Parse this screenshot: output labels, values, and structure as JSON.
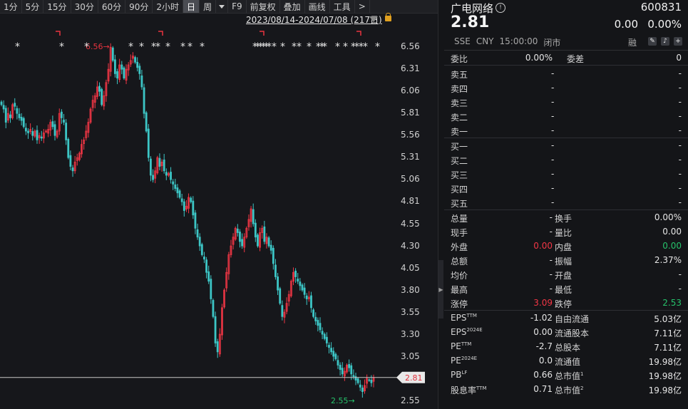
{
  "toolbar": {
    "periods": [
      "1分",
      "5分",
      "15分",
      "30分",
      "60分",
      "90分",
      "2小时",
      "日",
      "周"
    ],
    "active": "日",
    "tools": [
      "F9",
      "前复权",
      "叠加",
      "画线",
      "工具",
      ">"
    ]
  },
  "chart": {
    "range_label": "2023/08/14-2024/07/08 (217日)",
    "current_price_tag": "2.81",
    "high_label": "6.56→",
    "low_label": "2.55→",
    "y_ticks": [
      "6.56",
      "6.31",
      "6.06",
      "5.81",
      "5.56",
      "5.31",
      "5.06",
      "4.81",
      "4.55",
      "4.30",
      "4.05",
      "3.80",
      "3.55",
      "3.30",
      "3.05",
      "2.81",
      "2.55"
    ],
    "colors": {
      "up": "#f23645",
      "down": "#3dc6c6",
      "marker_red": "#e8333f",
      "green_label": "#26c26b"
    }
  },
  "chart_data": {
    "type": "candlestick",
    "ylim": [
      2.55,
      6.56
    ],
    "current": 2.81,
    "high": 6.56,
    "low": 2.55,
    "closes": [
      5.9,
      5.85,
      5.7,
      5.8,
      5.75,
      5.9,
      5.88,
      5.8,
      5.75,
      5.72,
      5.65,
      5.6,
      5.58,
      5.62,
      5.55,
      5.6,
      5.5,
      5.55,
      5.52,
      5.58,
      5.6,
      5.62,
      5.7,
      5.65,
      5.55,
      5.6,
      5.8,
      5.75,
      5.7,
      5.5,
      5.3,
      5.2,
      5.15,
      5.25,
      5.3,
      5.35,
      5.45,
      5.5,
      5.6,
      5.7,
      5.85,
      5.95,
      6.0,
      6.1,
      6.05,
      5.9,
      6.0,
      6.15,
      6.3,
      6.55,
      6.4,
      6.25,
      6.2,
      6.35,
      6.3,
      6.2,
      6.3,
      6.35,
      6.4,
      6.45,
      6.38,
      6.32,
      6.25,
      6.1,
      5.8,
      5.6,
      5.3,
      5.1,
      5.05,
      5.15,
      5.3,
      5.2,
      5.25,
      5.15,
      5.1,
      5.12,
      5.05,
      5.0,
      4.95,
      4.9,
      4.85,
      4.8,
      4.7,
      4.75,
      4.85,
      4.8,
      4.65,
      4.5,
      4.4,
      4.3,
      4.2,
      4.15,
      4.0,
      3.9,
      3.7,
      3.5,
      3.2,
      3.1,
      3.3,
      3.6,
      3.8,
      4.0,
      4.2,
      4.3,
      4.4,
      4.5,
      4.45,
      4.35,
      4.3,
      4.4,
      4.5,
      4.6,
      4.72,
      4.55,
      4.4,
      4.3,
      4.45,
      4.5,
      4.35,
      4.4,
      4.3,
      4.25,
      4.1,
      3.95,
      3.8,
      3.65,
      3.5,
      3.55,
      3.65,
      3.75,
      3.9,
      4.0,
      3.95,
      3.9,
      3.85,
      3.8,
      3.75,
      3.7,
      3.72,
      3.6,
      3.5,
      3.45,
      3.4,
      3.35,
      3.3,
      3.25,
      3.2,
      3.15,
      3.1,
      3.05,
      3.02,
      2.95,
      2.9,
      2.85,
      2.88,
      2.95,
      2.92,
      2.85,
      2.82,
      2.78,
      2.75,
      2.7,
      2.65,
      2.72,
      2.8,
      2.78,
      2.75,
      2.81
    ]
  },
  "quote": {
    "name": "广电网络",
    "code": "600831",
    "price": "2.81",
    "change": "0.00",
    "change_pct": "0.00%",
    "exchange": "SSE",
    "currency": "CNY",
    "time": "15:00:00",
    "status": "闭市",
    "rong": "融"
  },
  "orderbook": {
    "weibi_label": "委比",
    "weibi": "0.00%",
    "weicha_label": "委差",
    "weicha": "0",
    "asks": [
      {
        "label": "卖五",
        "price": "-",
        "vol": "-"
      },
      {
        "label": "卖四",
        "price": "-",
        "vol": "-"
      },
      {
        "label": "卖三",
        "price": "-",
        "vol": "-"
      },
      {
        "label": "卖二",
        "price": "-",
        "vol": "-"
      },
      {
        "label": "卖一",
        "price": "-",
        "vol": "-"
      }
    ],
    "bids": [
      {
        "label": "买一",
        "price": "-",
        "vol": "-"
      },
      {
        "label": "买二",
        "price": "-",
        "vol": "-"
      },
      {
        "label": "买三",
        "price": "-",
        "vol": "-"
      },
      {
        "label": "买四",
        "price": "-",
        "vol": "-"
      },
      {
        "label": "买五",
        "price": "-",
        "vol": "-"
      }
    ]
  },
  "stats": [
    {
      "l1": "总量",
      "v1": "-",
      "l2": "换手",
      "v2": "0.00%"
    },
    {
      "l1": "现手",
      "v1": "-",
      "l2": "量比",
      "v2": "0.00"
    },
    {
      "l1": "外盘",
      "v1": "0.00",
      "l2": "内盘",
      "v2": "0.00",
      "c1": "red",
      "c2": "green"
    },
    {
      "l1": "总额",
      "v1": "-",
      "l2": "振幅",
      "v2": "2.37%"
    },
    {
      "l1": "均价",
      "v1": "-",
      "l2": "开盘",
      "v2": "-"
    },
    {
      "l1": "最高",
      "v1": "-",
      "l2": "最低",
      "v2": "-"
    },
    {
      "l1": "涨停",
      "v1": "3.09",
      "l2": "跌停",
      "v2": "2.53",
      "c1": "red",
      "c2": "green"
    }
  ],
  "fundamentals": [
    {
      "l1": "EPS",
      "s1": "TTM",
      "v1": "-1.02",
      "l2": "自由流通",
      "v2": "5.03亿"
    },
    {
      "l1": "EPS",
      "s1": "2024E",
      "v1": "0.00",
      "l2": "流通股本",
      "v2": "7.11亿"
    },
    {
      "l1": "PE",
      "s1": "TTM",
      "v1": "-2.7",
      "l2": "总股本",
      "v2": "7.11亿"
    },
    {
      "l1": "PE",
      "s1": "2024E",
      "v1": "0.0",
      "l2": "流通值",
      "v2": "19.98亿"
    },
    {
      "l1": "PB",
      "s1": "LF",
      "v1": "0.66",
      "l2": "总市值",
      "s2": "1",
      "v2": "19.98亿"
    },
    {
      "l1": "股息率",
      "s1": "TTM",
      "v1": "0.71",
      "l2": "总市值",
      "s2": "2",
      "v2": "19.98亿"
    }
  ]
}
